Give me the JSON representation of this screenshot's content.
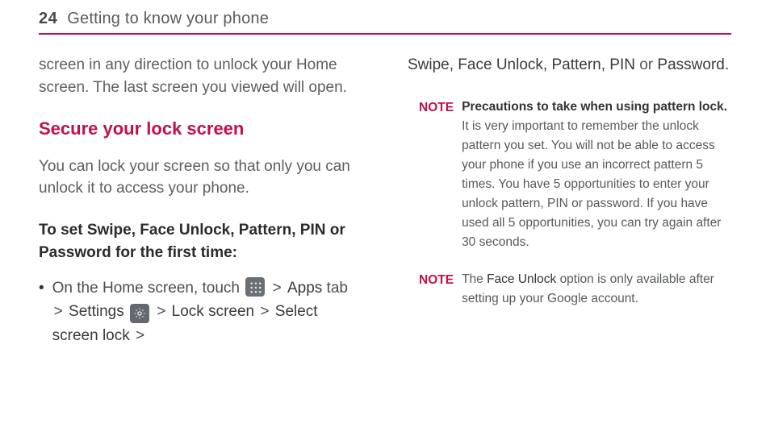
{
  "header": {
    "page_number": "24",
    "chapter_title": "Getting to know your phone"
  },
  "left": {
    "cont_paragraph": "screen in any direction to unlock your Home screen. The last screen you viewed will open.",
    "section_heading": "Secure your lock screen",
    "intro": "You can lock your screen so that only you can unlock it to access your phone.",
    "instr_heading": "To set Swipe, Face Unlock, Pattern, PIN or Password for the first time:",
    "bullet": {
      "prefix": "On the Home screen, touch",
      "apps_label": "Apps",
      "tab_word": "tab",
      "settings_label": "Settings",
      "lock_screen_label": "Lock screen",
      "select_lock_label": "Select screen lock",
      "gt": ">"
    }
  },
  "right": {
    "continuation_bold": "Swipe, Face Unlock, Pattern, PIN",
    "continuation_tail_or": "or",
    "continuation_tail_pw": "Password.",
    "note1": {
      "label": "NOTE",
      "heading": "Precautions to take when using pattern lock.",
      "body": "It is very important to remember the unlock pattern you set. You will not be able to access your phone if you use an incorrect pattern 5 times. You have 5 opportunities to enter your unlock pattern, PIN or password. If you have used all 5 opportunities, you can try again after 30 seconds."
    },
    "note2": {
      "label": "NOTE",
      "pre": "The",
      "face_unlock": "Face Unlock",
      "post": "option is only available after setting up your Google account."
    }
  },
  "colors": {
    "accent": "#bf114b"
  }
}
